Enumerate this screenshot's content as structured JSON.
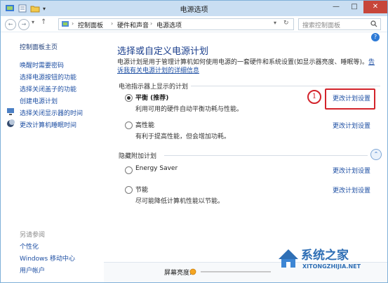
{
  "window": {
    "title": "电源选项",
    "controls": {
      "minimize": "—",
      "maximize": "□",
      "close": "✕"
    }
  },
  "toolbar": {
    "back": "←",
    "forward": "→",
    "up": "↑",
    "recent": "▾",
    "breadcrumb": [
      "控制面板",
      "硬件和声音",
      "电源选项"
    ],
    "refresh": "↻",
    "search_placeholder": "搜索控制面板",
    "help": "?"
  },
  "sidebar": {
    "home": "控制面板主页",
    "links": [
      "唤醒时需要密码",
      "选择电源按钮的功能",
      "选择关闭盖子的功能",
      "创建电源计划",
      "选择关闭显示器的时间",
      "更改计算机睡眠时间"
    ],
    "see_also_title": "另请参阅",
    "see_also": [
      "个性化",
      "Windows 移动中心",
      "用户帐户"
    ]
  },
  "main": {
    "heading": "选择或自定义电源计划",
    "description": "电源计划是用于管理计算机如何使用电源的一套硬件和系统设置(如显示器亮度、睡眠等)。",
    "description_link": "告诉我有关电源计划的详细信息",
    "section_preferred": "电池指示器上显示的计划",
    "section_hidden": "隐藏附加计划",
    "collapse_icon": "⌃",
    "change_label": "更改计划设置",
    "plans": [
      {
        "name": "平衡 (推荐)",
        "desc": "利用可用的硬件自动平衡功耗与性能。",
        "selected": true
      },
      {
        "name": "高性能",
        "desc": "有利于提高性能，但会增加功耗。",
        "selected": false
      }
    ],
    "hidden_plans": [
      {
        "name": "Energy Saver",
        "desc": "",
        "selected": false
      },
      {
        "name": "节能",
        "desc": "尽可能降低计算机性能以节能。",
        "selected": false
      }
    ],
    "callout_number": "1"
  },
  "status": {
    "brightness_label": "屏幕亮度:"
  },
  "watermark": {
    "main": "系统之家",
    "sub": "XITONGZHIJIA.NET"
  },
  "colors": {
    "accent": "#1e4fa3",
    "heading": "#1a3e8c",
    "callout": "#d3242b",
    "titlebar": "#c9def2"
  }
}
